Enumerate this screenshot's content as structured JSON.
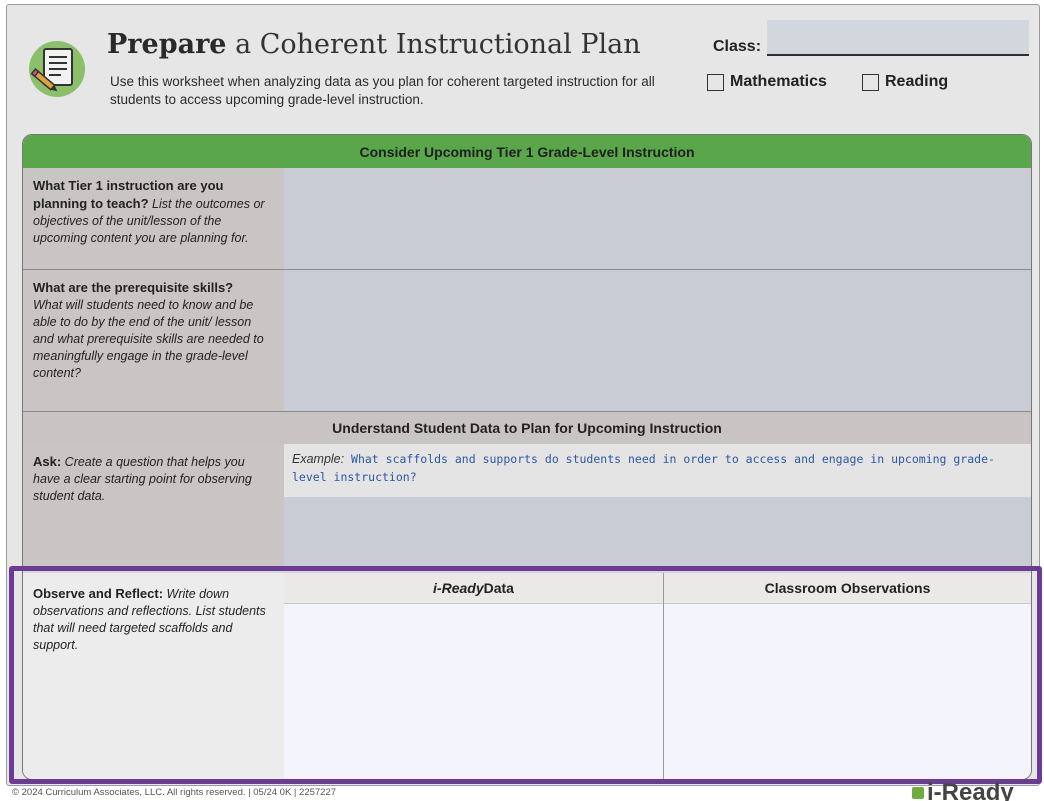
{
  "header": {
    "title_strong": "Prepare",
    "title_rest": " a Coherent Instructional Plan",
    "subtitle": "Use this worksheet when analyzing data as you plan for coherent targeted instruction for all students to access upcoming grade-level instruction.",
    "class_label": "Class:",
    "options": [
      "Mathematics",
      "Reading"
    ]
  },
  "sections": {
    "tier1_heading": "Consider Upcoming Tier 1 Grade-Level Instruction",
    "data_heading": "Understand Student Data to Plan for Upcoming Instruction"
  },
  "rows": {
    "tier1": {
      "question": "What Tier 1 instruction are you planning to teach?",
      "hint": " List the outcomes or objectives of the unit/lesson of the upcoming content you are planning for."
    },
    "prereq": {
      "question": "What are the prerequisite skills?",
      "hint": "What will students need to know and be able to do by the end of the unit/ lesson and what prerequisite skills are needed to meaningfully engage in the grade-level content?"
    },
    "ask": {
      "label": "Ask:",
      "hint": " Create a question that helps you have a clear starting point for observing student data.",
      "example_label": "Example:",
      "example_text": " What scaffolds and supports do students need in order to access and engage in upcoming grade-level instruction?"
    },
    "observe": {
      "label": "Observe and Reflect:",
      "hint_italic": " Write down",
      "hint_rest": " observations and reflections. List students that will need targeted scaffolds and support.",
      "col1_brand": "i-Ready",
      "col1_rest": " Data",
      "col2": "Classroom Observations"
    }
  },
  "footer": {
    "copyright": "© 2024 Curriculum Associates, LLC. All rights reserved.  |  05/24 0K  |  2257227",
    "brand": "i-Ready"
  },
  "colors": {
    "green_band": "#5aa64a",
    "gray_band": "#c8c4c4",
    "input_fill": "#c9ccd4",
    "highlight": "#6b3b95",
    "example_text": "#2d56a0"
  }
}
